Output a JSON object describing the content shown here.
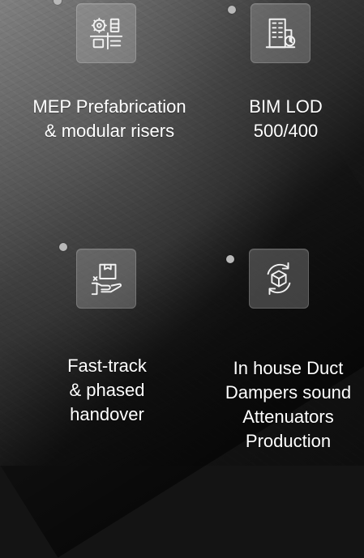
{
  "tiles": [
    {
      "icon": "prefabrication-icon",
      "label_lines": [
        "MEP Prefabrication",
        "& modular risers"
      ]
    },
    {
      "icon": "bim-building-icon",
      "label_lines": [
        "BIM LOD",
        "500/400"
      ]
    },
    {
      "icon": "handover-box-hand-icon",
      "label_lines": [
        "Fast-track",
        "& phased",
        "handover"
      ]
    },
    {
      "icon": "production-cycle-icon",
      "label_lines": [
        "In house Duct",
        "Dampers sound",
        "Attenuators",
        "Production"
      ]
    }
  ]
}
